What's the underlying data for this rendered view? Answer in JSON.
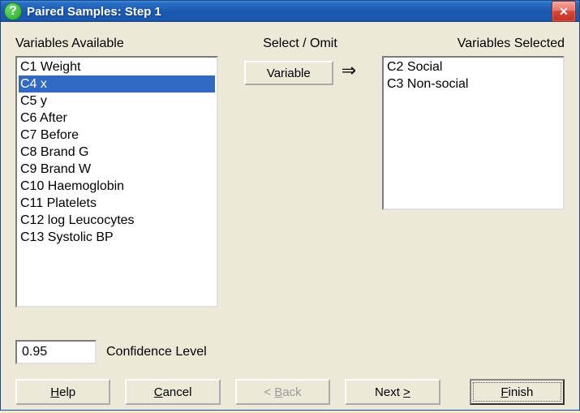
{
  "window": {
    "title": "Paired Samples: Step 1"
  },
  "labels": {
    "available": "Variables Available",
    "selectOmit": "Select / Omit",
    "selected": "Variables Selected",
    "variableBtn": "Variable",
    "confidence": "Confidence Level"
  },
  "available": {
    "items": [
      "C1 Weight",
      "C4 x",
      "C5 y",
      "C6 After",
      "C7 Before",
      "C8 Brand G",
      "C9 Brand W",
      "C10 Haemoglobin",
      "C11 Platelets",
      "C12 log Leucocytes",
      "C13 Systolic BP"
    ],
    "selected_index": 1
  },
  "selected": {
    "items": [
      "C2 Social",
      "C3 Non-social"
    ]
  },
  "confidence_value": "0.95",
  "buttons": {
    "help_pre": "",
    "help_u": "H",
    "help_post": "elp",
    "cancel_pre": "",
    "cancel_u": "C",
    "cancel_post": "ancel",
    "back_pre": "< ",
    "back_u": "B",
    "back_post": "ack",
    "next_pre": "Next ",
    "next_u": ">",
    "next_post": "",
    "finish_pre": "",
    "finish_u": "F",
    "finish_post": "inish"
  }
}
